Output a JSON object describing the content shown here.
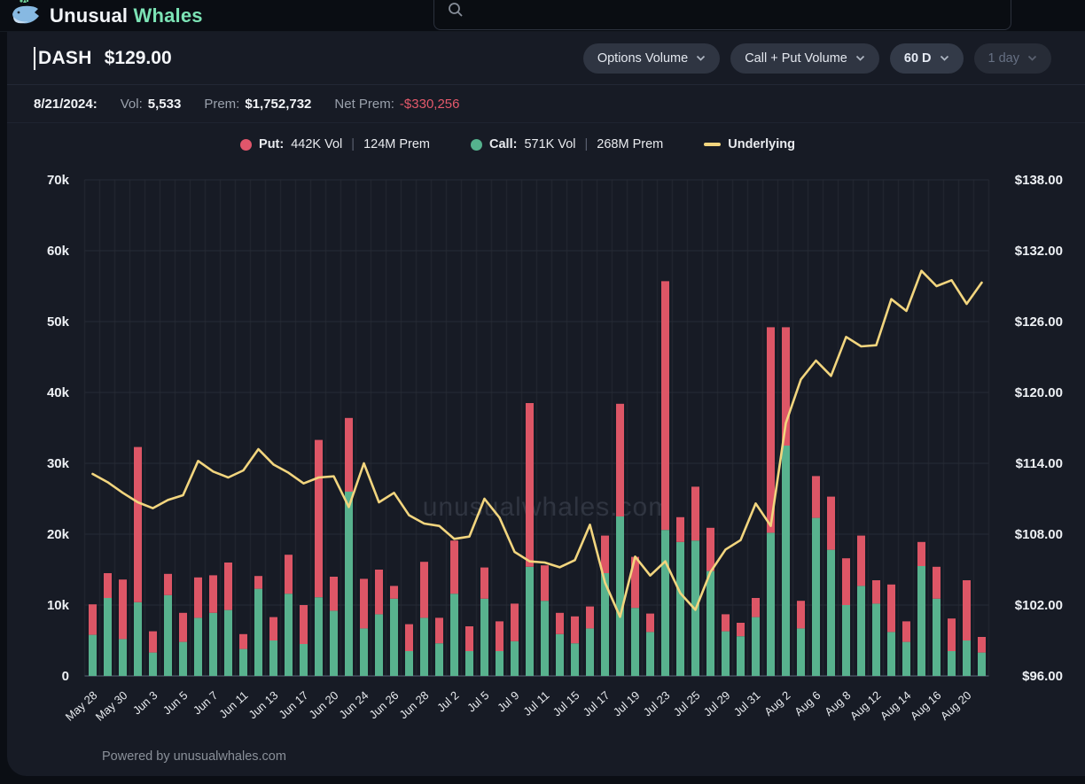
{
  "nav": {
    "brand_first": "Unusual",
    "brand_second": "Whales"
  },
  "header": {
    "ticker": "DASH",
    "price": "$129.00",
    "controls": [
      {
        "label": "Options Volume",
        "disabled": false
      },
      {
        "label": "Call + Put Volume",
        "disabled": false
      },
      {
        "label": "60 D",
        "disabled": false
      },
      {
        "label": "1 day",
        "disabled": true
      }
    ]
  },
  "stats": {
    "date": "8/21/2024:",
    "vol_label": "Vol:",
    "vol_value": "5,533",
    "prem_label": "Prem:",
    "prem_value": "$1,752,732",
    "net_prem_label": "Net Prem:",
    "net_prem_value": "-$330,256"
  },
  "legend": {
    "put_label": "Put:",
    "put_vol": "442K Vol",
    "put_prem": "124M Prem",
    "call_label": "Call:",
    "call_vol": "571K Vol",
    "call_prem": "268M Prem",
    "underlying_label": "Underlying",
    "separator": "|"
  },
  "watermark": "unusualwhales.com",
  "footer_text": "Powered by unusualwhales.com",
  "colors": {
    "put": "#dd5666",
    "call": "#58b28e",
    "underlying": "#f2d57e",
    "grid_h": "#262b36",
    "grid_v": "#20242e",
    "baseline": "#3a4150",
    "axis_text": "#edf0f4",
    "x_text": "#e7eaee",
    "watermark": "#404653",
    "negative": "#e4596b"
  },
  "chart_data": {
    "type": "bar",
    "subtype": "stacked-bars-with-line",
    "unit": "contracts (thousands) left axis, USD right axis",
    "tick_step": 2,
    "categories": [
      "May 28",
      "May 29",
      "May 30",
      "May 31",
      "Jun 3",
      "Jun 4",
      "Jun 5",
      "Jun 6",
      "Jun 7",
      "Jun 10",
      "Jun 11",
      "Jun 12",
      "Jun 13",
      "Jun 14",
      "Jun 17",
      "Jun 18",
      "Jun 20",
      "Jun 21",
      "Jun 24",
      "Jun 25",
      "Jun 26",
      "Jun 27",
      "Jun 28",
      "Jul 1",
      "Jul 2",
      "Jul 3",
      "Jul 5",
      "Jul 8",
      "Jul 9",
      "Jul 10",
      "Jul 11",
      "Jul 12",
      "Jul 15",
      "Jul 16",
      "Jul 17",
      "Jul 18",
      "Jul 19",
      "Jul 22",
      "Jul 23",
      "Jul 24",
      "Jul 25",
      "Jul 26",
      "Jul 29",
      "Jul 30",
      "Jul 31",
      "Aug 1",
      "Aug 2",
      "Aug 5",
      "Aug 6",
      "Aug 7",
      "Aug 8",
      "Aug 9",
      "Aug 12",
      "Aug 13",
      "Aug 14",
      "Aug 15",
      "Aug 16",
      "Aug 19",
      "Aug 20",
      "Aug 21"
    ],
    "series": [
      {
        "name": "Call",
        "values": [
          5.8,
          11,
          5.2,
          10.4,
          3.3,
          11.4,
          4.8,
          8.2,
          8.9,
          9.3,
          3.8,
          12.3,
          5,
          11.6,
          4.5,
          11.1,
          9.2,
          26,
          6.7,
          8.7,
          10.9,
          3.5,
          8.2,
          4.6,
          11.6,
          3.5,
          10.9,
          3.5,
          4.9,
          15.4,
          10.6,
          5.9,
          4.6,
          6.7,
          14.5,
          22.5,
          9.6,
          6.2,
          20.6,
          18.9,
          19.1,
          14.8,
          6.3,
          5.6,
          8.3,
          20.2,
          32.5,
          6.7,
          22.3,
          17.8,
          10,
          12.7,
          10.2,
          6.2,
          4.8,
          15.5,
          10.9,
          3.5,
          5,
          3.3
        ]
      },
      {
        "name": "Put",
        "values": [
          4.3,
          3.5,
          8.4,
          21.9,
          3,
          3,
          4.1,
          5.7,
          5.3,
          6.7,
          2.1,
          1.8,
          3.3,
          5.5,
          5.5,
          22.2,
          4.8,
          10.4,
          7,
          6.3,
          1.8,
          3.8,
          7.9,
          3.6,
          7.5,
          3.5,
          4.4,
          4.2,
          5.3,
          23.1,
          5,
          3,
          3.8,
          3.1,
          5.3,
          15.9,
          7.2,
          2.6,
          35.1,
          3.5,
          7.6,
          6.1,
          2.4,
          1.9,
          2.7,
          29,
          16.7,
          3.9,
          5.9,
          7.5,
          6.6,
          7.1,
          3.3,
          6.7,
          2.9,
          3.4,
          4.5,
          4.6,
          8.5,
          2.2
        ]
      },
      {
        "name": "Underlying",
        "values": [
          113.1,
          112.4,
          111.5,
          110.7,
          110.2,
          110.9,
          111.3,
          114.2,
          113.3,
          112.8,
          113.4,
          115.2,
          113.9,
          113.2,
          112.3,
          112.8,
          112.9,
          110.3,
          114,
          110.7,
          111.5,
          109.6,
          108.9,
          108.7,
          107.6,
          107.8,
          111,
          109.4,
          106.5,
          105.7,
          105.6,
          105.2,
          105.8,
          108.8,
          103.9,
          101,
          106.1,
          104.5,
          105.7,
          103,
          101.6,
          104.8,
          106.7,
          107.5,
          110.6,
          108.7,
          117.4,
          121.1,
          122.7,
          121.4,
          124.7,
          123.9,
          124,
          127.9,
          126.9,
          130.3,
          129,
          129.5,
          127.5,
          129.3
        ]
      }
    ],
    "left_axis": {
      "ticks": [
        "0",
        "10k",
        "20k",
        "30k",
        "40k",
        "50k",
        "60k",
        "70k"
      ],
      "min": 0,
      "max": 70000
    },
    "right_axis": {
      "ticks": [
        "$96.00",
        "$102.00",
        "$108.00",
        "$114.00",
        "$120.00",
        "$126.00",
        "$132.00",
        "$138.00"
      ],
      "min": 96,
      "max": 138
    }
  }
}
